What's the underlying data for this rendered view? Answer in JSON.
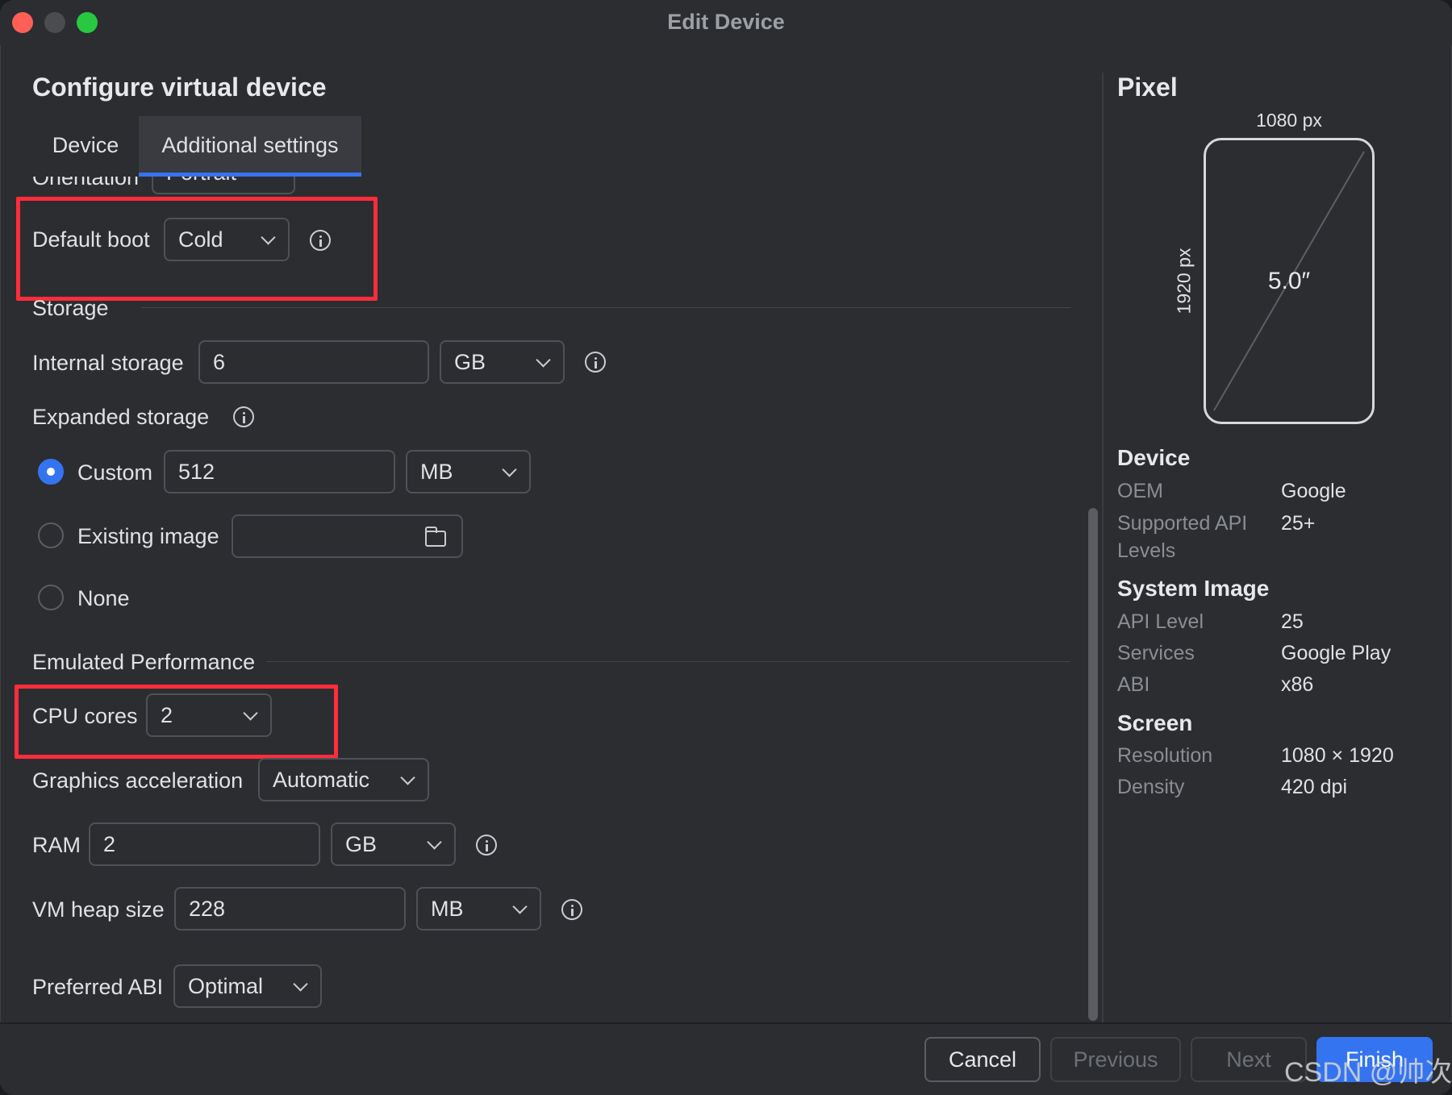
{
  "window": {
    "title": "Edit Device"
  },
  "heading": "Configure virtual device",
  "tabs": [
    {
      "label": "Device"
    },
    {
      "label": "Additional settings"
    }
  ],
  "partial_row": {
    "label": "Orientation",
    "value": "Portrait"
  },
  "default_boot": {
    "label": "Default boot",
    "value": "Cold"
  },
  "storage": {
    "section": "Storage",
    "internal": {
      "label": "Internal storage",
      "value": "6",
      "unit": "GB"
    },
    "expanded": {
      "label": "Expanded storage",
      "custom": {
        "label": "Custom",
        "value": "512",
        "unit": "MB",
        "selected": true
      },
      "existing": {
        "label": "Existing image",
        "value": "",
        "selected": false
      },
      "none": {
        "label": "None",
        "selected": false
      }
    }
  },
  "performance": {
    "section": "Emulated Performance",
    "cpu": {
      "label": "CPU cores",
      "value": "2"
    },
    "graphics": {
      "label": "Graphics acceleration",
      "value": "Automatic"
    },
    "ram": {
      "label": "RAM",
      "value": "2",
      "unit": "GB"
    },
    "vm_heap": {
      "label": "VM heap size",
      "value": "228",
      "unit": "MB"
    },
    "abi": {
      "label": "Preferred ABI",
      "value": "Optimal"
    }
  },
  "sidebar": {
    "title": "Pixel",
    "width_px": "1080 px",
    "height_px": "1920 px",
    "size": "5.0″",
    "device": {
      "title": "Device",
      "rows": [
        {
          "key": "OEM",
          "value": "Google"
        },
        {
          "key": "Supported API Levels",
          "value": "25+"
        }
      ]
    },
    "system_image": {
      "title": "System Image",
      "rows": [
        {
          "key": "API Level",
          "value": "25"
        },
        {
          "key": "Services",
          "value": "Google Play"
        },
        {
          "key": "ABI",
          "value": "x86"
        }
      ]
    },
    "screen": {
      "title": "Screen",
      "rows": [
        {
          "key": "Resolution",
          "value": "1080 × 1920"
        },
        {
          "key": "Density",
          "value": "420 dpi"
        }
      ]
    }
  },
  "footer": {
    "cancel": "Cancel",
    "previous": "Previous",
    "next": "Next",
    "finish": "Finish"
  },
  "watermark": "CSDN @帅次",
  "colors": {
    "accent": "#3574f0",
    "highlight_box": "#ff2d3b",
    "background": "#2b2d30"
  }
}
